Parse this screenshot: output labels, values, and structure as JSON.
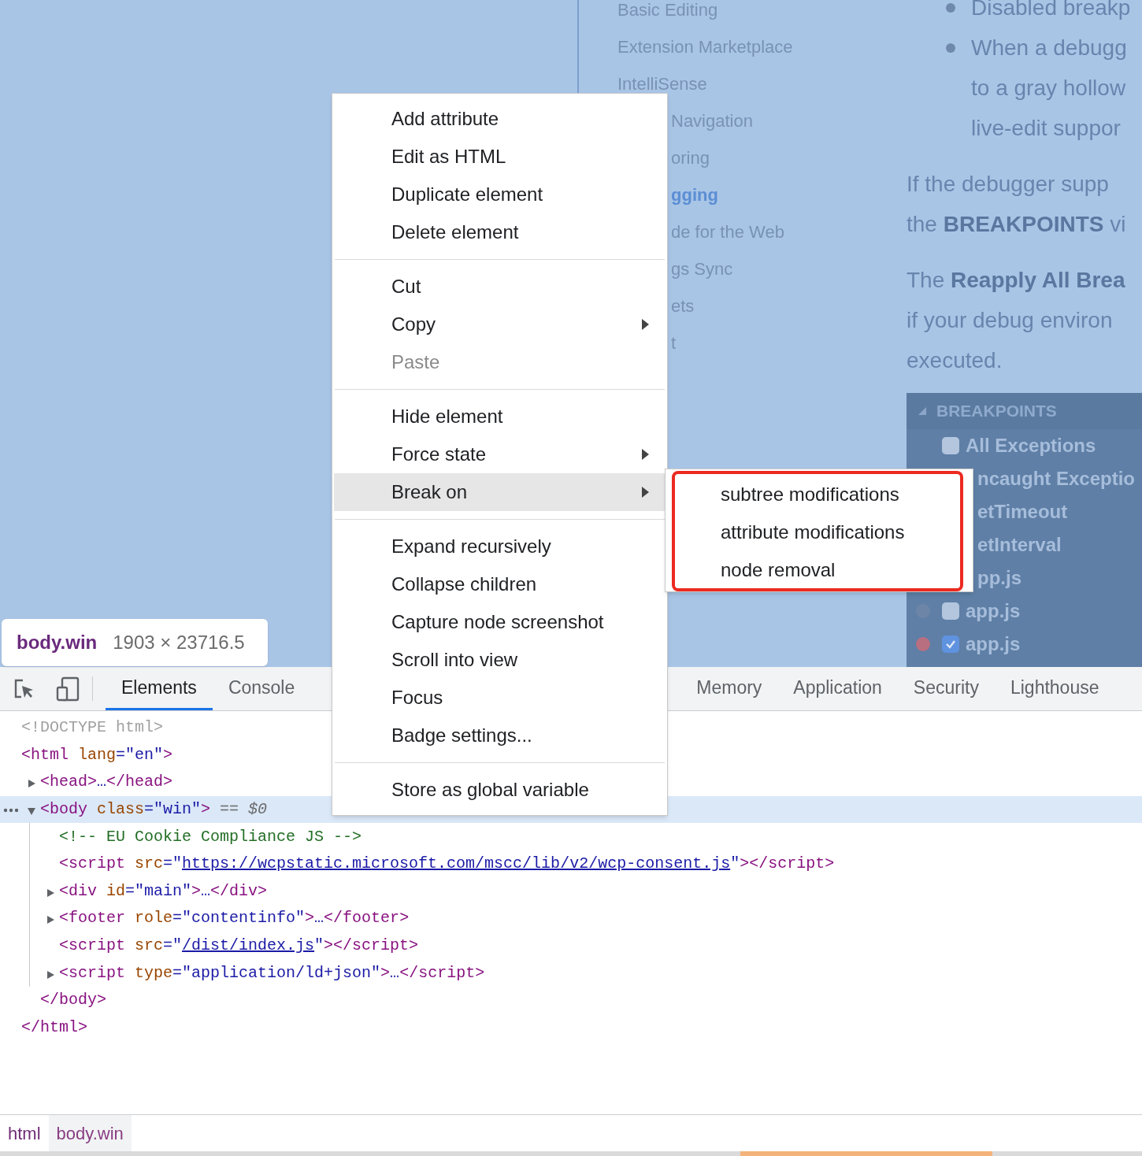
{
  "page": {
    "nav_items": [
      {
        "label": "Basic Editing",
        "kind": "full",
        "selected": false
      },
      {
        "label": "Extension Marketplace",
        "kind": "full",
        "selected": false
      },
      {
        "label": "IntelliSense",
        "kind": "full",
        "selected": false
      },
      {
        "label": "Navigation",
        "kind": "clipped",
        "selected": false
      },
      {
        "label": "oring",
        "kind": "clipped",
        "selected": false
      },
      {
        "label": "gging",
        "kind": "clipped",
        "selected": true
      },
      {
        "label": "de for the Web",
        "kind": "clipped",
        "selected": false
      },
      {
        "label": "gs Sync",
        "kind": "clipped",
        "selected": false
      },
      {
        "label": "ets",
        "kind": "clipped",
        "selected": false
      },
      {
        "label": "t",
        "kind": "clipped",
        "selected": false
      }
    ],
    "bullets": [
      {
        "lines": [
          "Disabled breakp"
        ]
      },
      {
        "lines": [
          "When a debugg",
          "to a gray hollow",
          "live-edit suppor"
        ]
      }
    ],
    "paragraphs": [
      {
        "lines": [
          "If the debugger supp",
          "the **BREAKPOINTS** vi"
        ]
      },
      {
        "lines": [
          "The **Reapply All Brea**",
          "if your debug environ",
          "executed."
        ]
      }
    ],
    "breakpoints": {
      "title": "BREAKPOINTS",
      "items": [
        {
          "label": "All Exceptions",
          "kind": "full",
          "checked": false
        },
        {
          "label": "ncaught Exceptio",
          "kind": "clipped"
        },
        {
          "label": "etTimeout",
          "kind": "clipped"
        },
        {
          "label": "etInterval",
          "kind": "clipped"
        },
        {
          "label": "pp.js",
          "kind": "clipped"
        },
        {
          "label": "app.js",
          "kind": "full",
          "checked": false,
          "color": "#6d86a8"
        },
        {
          "label": "app.js",
          "kind": "full",
          "checked": true,
          "color": "#b86f80"
        }
      ]
    }
  },
  "tooltip": {
    "selector": "body.win",
    "size": "1903 × 23716.5"
  },
  "context_menu": {
    "groups": [
      {
        "items": [
          {
            "label": "Add attribute",
            "disabled": false,
            "has_submenu": false,
            "selected": false
          },
          {
            "label": "Edit as HTML",
            "disabled": false,
            "has_submenu": false,
            "selected": false
          },
          {
            "label": "Duplicate element",
            "disabled": false,
            "has_submenu": false,
            "selected": false
          },
          {
            "label": "Delete element",
            "disabled": false,
            "has_submenu": false,
            "selected": false
          }
        ]
      },
      {
        "items": [
          {
            "label": "Cut",
            "disabled": false,
            "has_submenu": false,
            "selected": false
          },
          {
            "label": "Copy",
            "disabled": false,
            "has_submenu": true,
            "selected": false
          },
          {
            "label": "Paste",
            "disabled": true,
            "has_submenu": false,
            "selected": false
          }
        ]
      },
      {
        "items": [
          {
            "label": "Hide element",
            "disabled": false,
            "has_submenu": false,
            "selected": false
          },
          {
            "label": "Force state",
            "disabled": false,
            "has_submenu": true,
            "selected": false
          },
          {
            "label": "Break on",
            "disabled": false,
            "has_submenu": true,
            "selected": true
          }
        ]
      },
      {
        "items": [
          {
            "label": "Expand recursively",
            "disabled": false,
            "has_submenu": false,
            "selected": false
          },
          {
            "label": "Collapse children",
            "disabled": false,
            "has_submenu": false,
            "selected": false
          },
          {
            "label": "Capture node screenshot",
            "disabled": false,
            "has_submenu": false,
            "selected": false
          },
          {
            "label": "Scroll into view",
            "disabled": false,
            "has_submenu": false,
            "selected": false
          },
          {
            "label": "Focus",
            "disabled": false,
            "has_submenu": false,
            "selected": false
          },
          {
            "label": "Badge settings...",
            "disabled": false,
            "has_submenu": false,
            "selected": false
          }
        ]
      },
      {
        "items": [
          {
            "label": "Store as global variable",
            "disabled": false,
            "has_submenu": false,
            "selected": false
          }
        ]
      }
    ]
  },
  "submenu": {
    "items": [
      "subtree modifications",
      "attribute modifications",
      "node removal"
    ]
  },
  "devtools": {
    "tabs": [
      {
        "label": "Elements",
        "selected": true
      },
      {
        "label": "Console",
        "selected": false
      }
    ],
    "tabs_after_menu": [
      {
        "label": "Memory",
        "selected": false
      },
      {
        "label": "Application",
        "selected": false
      },
      {
        "label": "Security",
        "selected": false
      },
      {
        "label": "Lighthouse",
        "selected": false
      }
    ],
    "tree": [
      {
        "tokens": [
          {
            "kind": "doctype",
            "text": "<!DOCTYPE html>"
          }
        ],
        "expandable": false,
        "selected": false
      },
      {
        "tokens": [
          {
            "kind": "tag",
            "text": "<html"
          },
          {
            "kind": "attr",
            "text": " lang"
          },
          {
            "kind": "punct",
            "text": "="
          },
          {
            "kind": "value",
            "text": "\"en\""
          },
          {
            "kind": "tag",
            "text": ">"
          }
        ],
        "expandable": false,
        "selected": false,
        "children": [
          {
            "tokens": [
              {
                "kind": "tag",
                "text": "<head>"
              },
              {
                "kind": "punct",
                "text": "…"
              },
              {
                "kind": "tag",
                "text": "</head>"
              }
            ],
            "expandable": true,
            "expanded": false,
            "selected": false
          },
          {
            "tokens": [
              {
                "kind": "tag",
                "text": "<body"
              },
              {
                "kind": "attr",
                "text": " class"
              },
              {
                "kind": "punct",
                "text": "="
              },
              {
                "kind": "value",
                "text": "\"win\""
              },
              {
                "kind": "tag",
                "text": ">"
              },
              {
                "kind": "marker",
                "text": " == $0"
              }
            ],
            "expandable": true,
            "expanded": true,
            "selected": true,
            "children": [
              {
                "tokens": [
                  {
                    "kind": "comment",
                    "text": "<!-- EU Cookie Compliance JS -->"
                  }
                ],
                "expandable": false,
                "selected": false
              },
              {
                "tokens": [
                  {
                    "kind": "tag",
                    "text": "<script"
                  },
                  {
                    "kind": "attr",
                    "text": " src"
                  },
                  {
                    "kind": "punct",
                    "text": "=\""
                  },
                  {
                    "kind": "link",
                    "text": "https://wcpstatic.microsoft.com/mscc/lib/v2/wcp-consent.js"
                  },
                  {
                    "kind": "punct",
                    "text": "\""
                  },
                  {
                    "kind": "tag",
                    "text": "></script>"
                  }
                ],
                "expandable": false,
                "selected": false
              },
              {
                "tokens": [
                  {
                    "kind": "tag",
                    "text": "<div"
                  },
                  {
                    "kind": "attr",
                    "text": " id"
                  },
                  {
                    "kind": "punct",
                    "text": "="
                  },
                  {
                    "kind": "value",
                    "text": "\"main\""
                  },
                  {
                    "kind": "tag",
                    "text": ">"
                  },
                  {
                    "kind": "punct",
                    "text": "…"
                  },
                  {
                    "kind": "tag",
                    "text": "</div>"
                  }
                ],
                "expandable": true,
                "expanded": false,
                "selected": false
              },
              {
                "tokens": [
                  {
                    "kind": "tag",
                    "text": "<footer"
                  },
                  {
                    "kind": "attr",
                    "text": " role"
                  },
                  {
                    "kind": "punct",
                    "text": "="
                  },
                  {
                    "kind": "value",
                    "text": "\"contentinfo\""
                  },
                  {
                    "kind": "tag",
                    "text": ">"
                  },
                  {
                    "kind": "punct",
                    "text": "…"
                  },
                  {
                    "kind": "tag",
                    "text": "</footer>"
                  }
                ],
                "expandable": true,
                "expanded": false,
                "selected": false
              },
              {
                "tokens": [
                  {
                    "kind": "tag",
                    "text": "<script"
                  },
                  {
                    "kind": "attr",
                    "text": " src"
                  },
                  {
                    "kind": "punct",
                    "text": "=\""
                  },
                  {
                    "kind": "link",
                    "text": "/dist/index.js"
                  },
                  {
                    "kind": "punct",
                    "text": "\""
                  },
                  {
                    "kind": "tag",
                    "text": "></script>"
                  }
                ],
                "expandable": false,
                "selected": false
              },
              {
                "tokens": [
                  {
                    "kind": "tag",
                    "text": "<script"
                  },
                  {
                    "kind": "attr",
                    "text": " type"
                  },
                  {
                    "kind": "punct",
                    "text": "="
                  },
                  {
                    "kind": "value",
                    "text": "\"application/ld+json\""
                  },
                  {
                    "kind": "tag",
                    "text": ">"
                  },
                  {
                    "kind": "punct",
                    "text": "…"
                  },
                  {
                    "kind": "tag",
                    "text": "</script>"
                  }
                ],
                "expandable": true,
                "expanded": false,
                "selected": false
              }
            ],
            "closing": [
              {
                "kind": "tag",
                "text": "</body>"
              }
            ]
          }
        ],
        "closing": [
          {
            "kind": "tag",
            "text": "</html>"
          }
        ]
      }
    ],
    "breadcrumbs": [
      {
        "label": "html",
        "selected": false
      },
      {
        "label": "body.win",
        "selected": true
      }
    ]
  }
}
